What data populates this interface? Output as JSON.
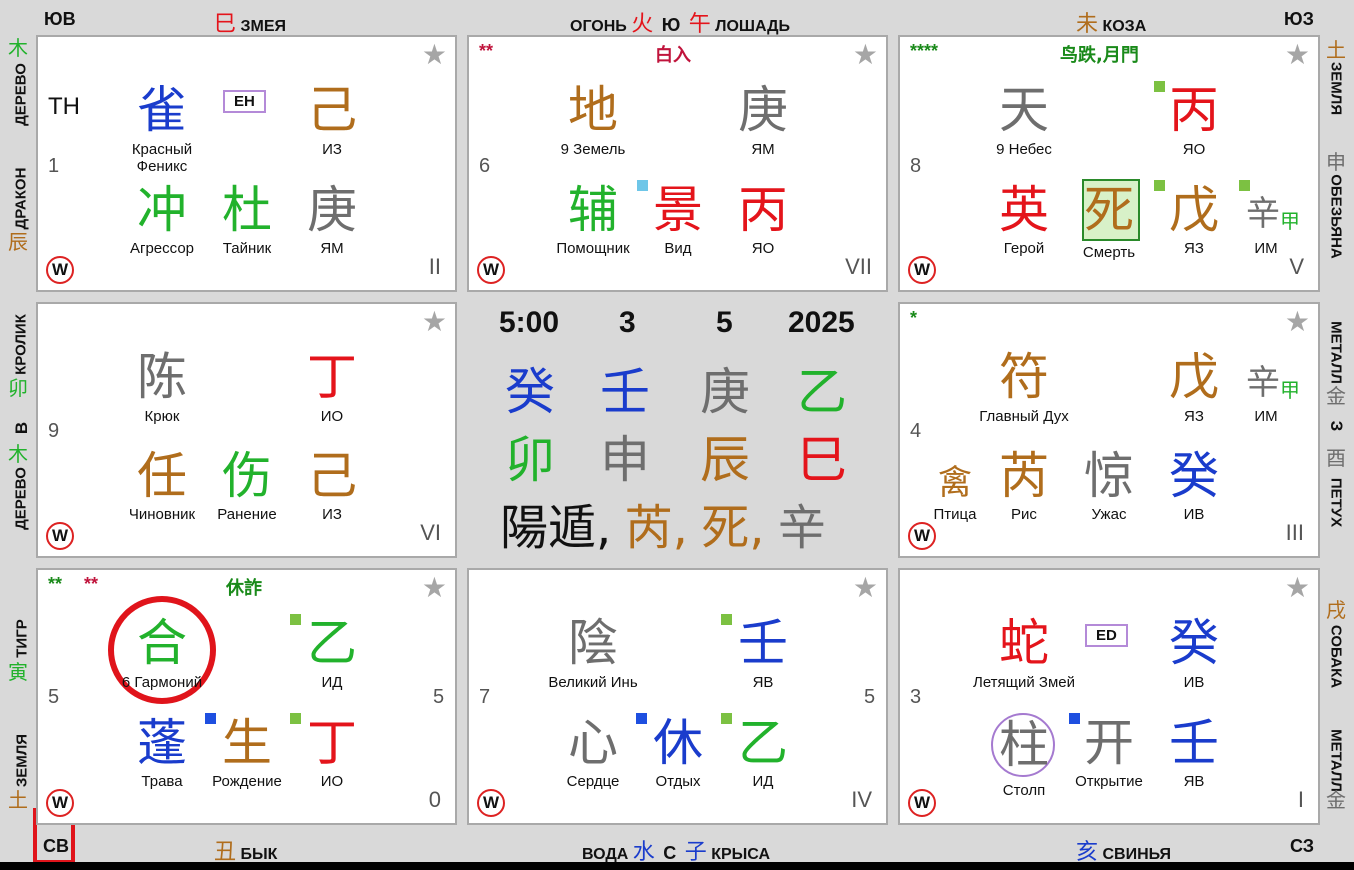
{
  "edges": {
    "top": {
      "left": "ЮВ",
      "snake_char": "巳",
      "snake": "ЗМЕЯ",
      "fire": "ОГОНЬ",
      "fire_char": "火",
      "dir": "Ю",
      "horse_char": "午",
      "horse": "ЛОШАДЬ",
      "goat_char": "未",
      "goat": "КОЗА",
      "right": "ЮЗ"
    },
    "bottom": {
      "left": "СВ",
      "ox_char": "丑",
      "ox": "БЫК",
      "water": "ВОДА",
      "water_char": "水",
      "dir": "С",
      "rat_char": "子",
      "rat": "КРЫСА",
      "pig_char": "亥",
      "pig": "СВИНЬЯ",
      "right": "СЗ"
    },
    "left": {
      "wood_char": "木",
      "wood": "ДЕРЕВО",
      "dragon": "ДРАКОН",
      "dragon_char": "辰",
      "rabbit": "КРОЛИК",
      "rabbit_char": "卯",
      "dir": "В",
      "wood2_char": "木",
      "wood2": "ДЕРЕВО",
      "tiger": "ТИГР",
      "tiger_char": "寅",
      "earth": "ЗЕМЛЯ",
      "earth_char": "土"
    },
    "right": {
      "earth_char": "土",
      "earth": "ЗЕМЛЯ",
      "monkey_char": "申",
      "monkey": "ОБЕЗЬЯНА",
      "metal": "МЕТАЛЛ",
      "metal_char": "金",
      "dir": "З",
      "rooster_char": "酉",
      "rooster": "ПЕТУХ",
      "dog_char": "戌",
      "dog": "СОБАКА",
      "metal2": "МЕТАЛЛ",
      "metal2_char": "金"
    }
  },
  "center": {
    "time": "5:00",
    "day": "3",
    "month": "5",
    "year": "2025",
    "stems": [
      "癸",
      "壬",
      "庚",
      "乙"
    ],
    "branches": [
      "卯",
      "申",
      "辰",
      "巳"
    ],
    "bottom": {
      "ju": "陽遁,",
      "c1": "芮,",
      "c2": "死,",
      "c3": "辛"
    }
  },
  "palaces": {
    "p4": {
      "left_label": "TH",
      "num": "1",
      "roman": "II",
      "badge": "EH",
      "deity": "雀",
      "deity_cap": "Красный Феникс",
      "heaven": "己",
      "heaven_cap": "ИЗ",
      "star_ch": "冲",
      "star_cap": "Агрессор",
      "door": "杜",
      "door_cap": "Тайник",
      "earth": "庚",
      "earth_cap": "ЯМ"
    },
    "p9": {
      "stars": "**",
      "title": "白入",
      "num": "6",
      "roman": "VII",
      "deity": "地",
      "deity_cap": "9 Земель",
      "heaven": "庚",
      "heaven_cap": "ЯМ",
      "star_ch": "辅",
      "star_cap": "Помощник",
      "door": "景",
      "door_cap": "Вид",
      "earth": "丙",
      "earth_cap": "ЯО"
    },
    "p2": {
      "stars": "****",
      "title": "鸟跌,月門",
      "num": "8",
      "roman": "V",
      "deity": "天",
      "deity_cap": "9 Небес",
      "heaven": "丙",
      "heaven_cap": "ЯО",
      "star_ch": "英",
      "star_cap": "Герой",
      "door": "死",
      "door_cap": "Смерть",
      "earth": "戊",
      "earth_cap": "ЯЗ",
      "extra": "辛",
      "extra_sub": "甲",
      "extra_cap": "ИМ"
    },
    "p3": {
      "num": "9",
      "roman": "VI",
      "deity": "陈",
      "deity_cap": "Крюк",
      "heaven": "丁",
      "heaven_cap": "ИО",
      "star_ch": "任",
      "star_cap": "Чиновник",
      "door": "伤",
      "door_cap": "Ранение",
      "earth": "己",
      "earth_cap": "ИЗ"
    },
    "p7": {
      "stars": "*",
      "num": "4",
      "roman": "III",
      "deity": "符",
      "deity_cap": "Главный Дух",
      "heaven": "戊",
      "heaven_cap": "ЯЗ",
      "extra": "辛",
      "extra_sub": "甲",
      "extra_cap": "ИМ",
      "small": "禽",
      "small_cap": "Птица",
      "star_ch": "芮",
      "star_cap": "Рис",
      "door": "惊",
      "door_cap": "Ужас",
      "earth": "癸",
      "earth_cap": "ИВ"
    },
    "p8": {
      "stars1": "**",
      "stars2": "**",
      "title": "休詐",
      "num": "5",
      "num_right": "5",
      "roman": "0",
      "deity": "合",
      "deity_cap": "6 Гармоний",
      "heaven": "乙",
      "heaven_cap": "ИД",
      "star_ch": "蓬",
      "star_cap": "Трава",
      "door": "生",
      "door_cap": "Рождение",
      "earth": "丁",
      "earth_cap": "ИО"
    },
    "p1": {
      "num": "7",
      "num_right": "5",
      "roman": "IV",
      "deity": "陰",
      "deity_cap": "Великий Инь",
      "heaven": "壬",
      "heaven_cap": "ЯВ",
      "star_ch": "心",
      "star_cap": "Сердце",
      "door": "休",
      "door_cap": "Отдых",
      "earth": "乙",
      "earth_cap": "ИД"
    },
    "p6": {
      "num": "3",
      "roman": "I",
      "badge": "ED",
      "deity": "蛇",
      "deity_cap": "Летящий Змей",
      "heaven": "癸",
      "heaven_cap": "ИВ",
      "star_ch": "柱",
      "star_cap": "Столп",
      "door": "开",
      "door_cap": "Открытие",
      "earth": "壬",
      "earth_cap": "ЯВ"
    }
  },
  "icons": {
    "star": "★",
    "w": "W"
  },
  "colors": {
    "red": "#e4141b",
    "brown": "#b06d1c",
    "green": "#22b22c",
    "blue": "#1a3ccc",
    "gray": "#6e6e6e"
  }
}
